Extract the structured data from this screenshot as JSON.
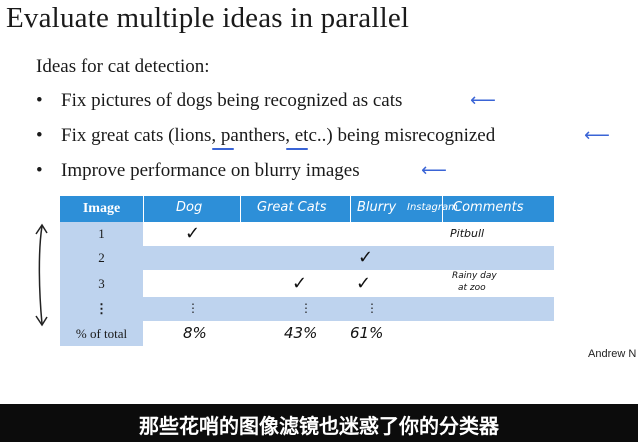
{
  "slide": {
    "title": "Evaluate multiple ideas in parallel",
    "subtitle": "Ideas for cat detection:",
    "bullet_char": "•",
    "bullets": [
      "Fix pictures of dogs being recognized as cats",
      "Fix great cats (lions, panthers, etc..) being misrecognized",
      "Improve performance on blurry images"
    ],
    "annotation_color": "#3a64d6"
  },
  "table": {
    "header_color": "#2d8fd8",
    "band_color": "#bed3ee",
    "headers": [
      "Image",
      "Dog",
      "Great Cats",
      "Blurry",
      "Instagram",
      "Comments"
    ],
    "rows": [
      {
        "image": "1",
        "dog": "✓",
        "great_cats": "",
        "blurry": "",
        "comments": "Pitbull"
      },
      {
        "image": "2",
        "dog": "",
        "great_cats": "",
        "blurry": "✓",
        "comments": ""
      },
      {
        "image": "3",
        "dog": "",
        "great_cats": "✓",
        "blurry": "✓",
        "comments_line1": "Rainy day",
        "comments_line2": "at zoo"
      },
      {
        "image": "⋮",
        "dog": "⋮",
        "great_cats": "⋮",
        "blurry": "⋮",
        "comments": ""
      }
    ],
    "total_label": "% of total",
    "totals": {
      "dog": "8%",
      "great_cats": "43%",
      "blurry": "61%"
    }
  },
  "author": "Andrew N",
  "subtitle_caption": "那些花哨的图像滤镜也迷惑了你的分类器"
}
